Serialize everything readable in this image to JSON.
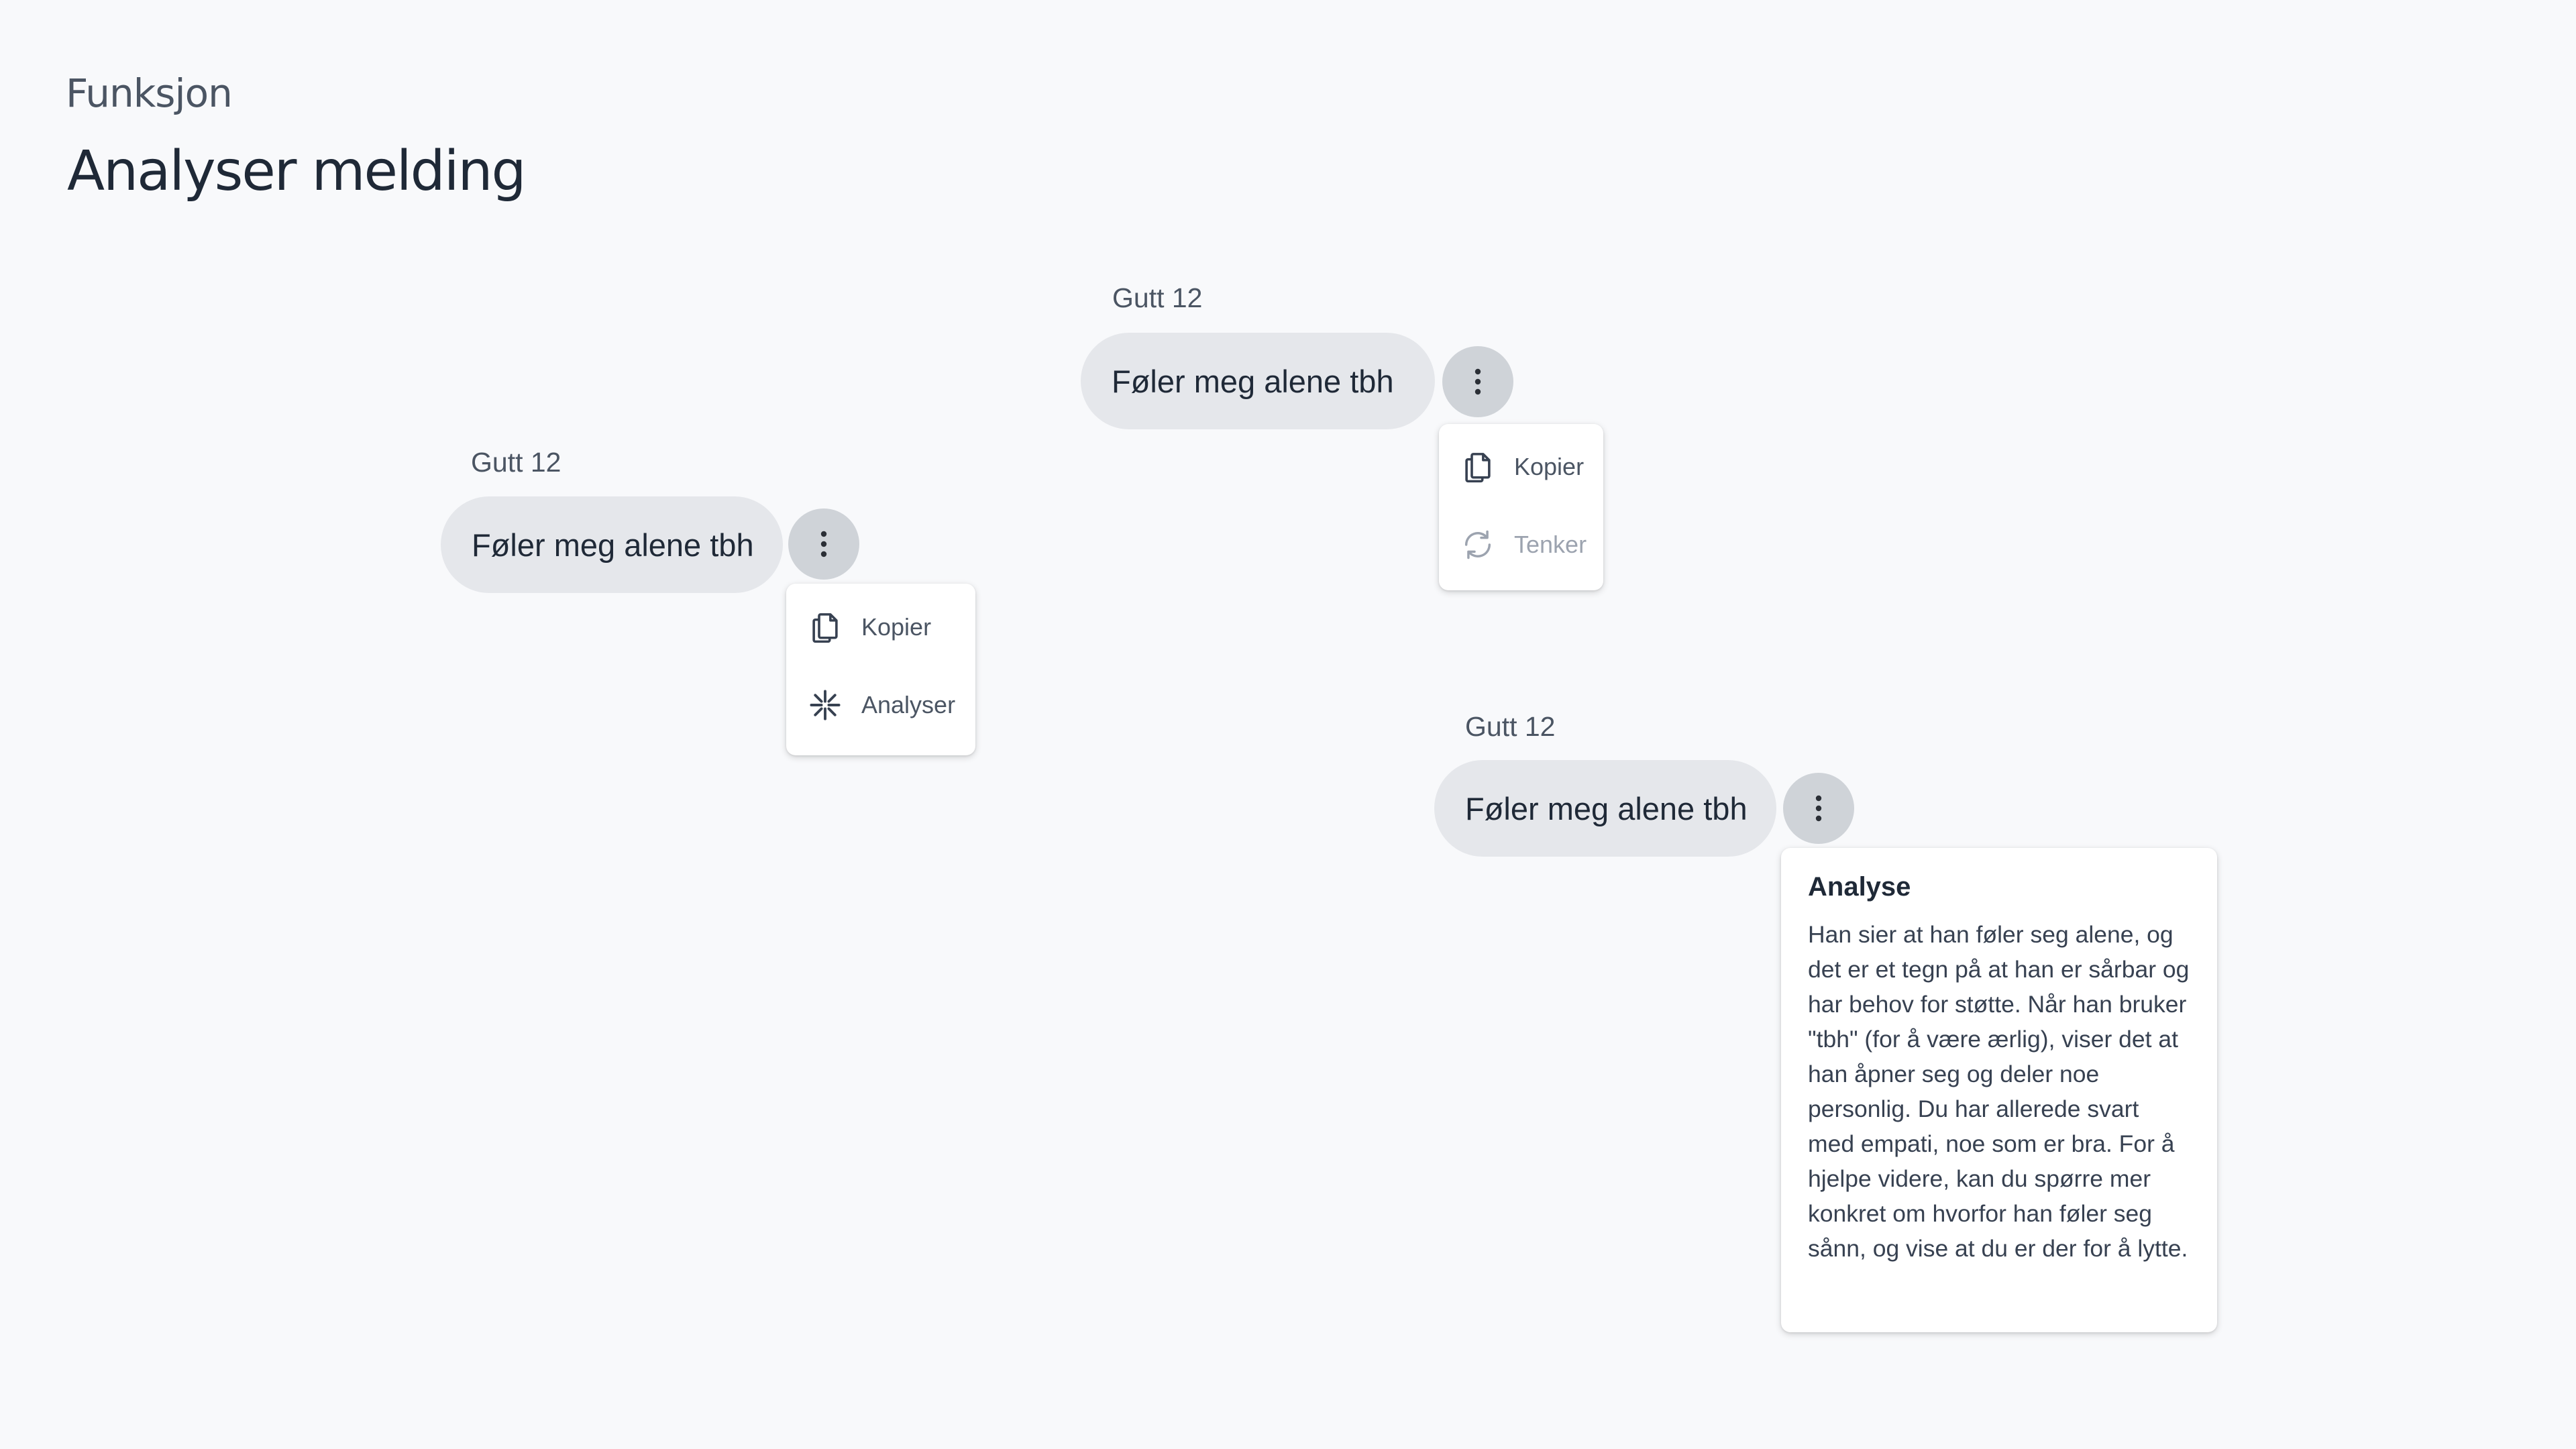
{
  "header": {
    "subtitle": "Funksjon",
    "title": "Analyser melding"
  },
  "messages": [
    {
      "sender": "Gutt 12",
      "text": "Føler meg alene tbh",
      "menu": [
        {
          "label": "Kopier",
          "icon": "copy-icon"
        },
        {
          "label": "Analyser",
          "icon": "sparkle-icon"
        }
      ]
    },
    {
      "sender": "Gutt 12",
      "text": "Føler meg alene tbh",
      "menu": [
        {
          "label": "Kopier",
          "icon": "copy-icon"
        },
        {
          "label": "Tenker",
          "icon": "loading-icon",
          "disabled": true
        }
      ]
    },
    {
      "sender": "Gutt 12",
      "text": "Føler meg alene tbh",
      "analysis": {
        "title": "Analyse",
        "body": "Han sier at han føler seg alene, og det er et tegn på at han er sårbar og har behov for støtte. Når han bruker \"tbh\" (for å være ærlig), viser det at han åpner seg og deler noe personlig. Du har allerede svart med empati, noe som er bra. For å hjelpe videre, kan du spørre mer konkret om hvorfor han føler seg sånn, og vise at du er der for å lytte."
      }
    }
  ],
  "colors": {
    "background": "#f8f9fb",
    "bubble": "#e5e7eb",
    "more_button": "#cfd3d8",
    "text": "#1f2937",
    "muted": "#4b5563",
    "disabled": "#9ca3af"
  }
}
